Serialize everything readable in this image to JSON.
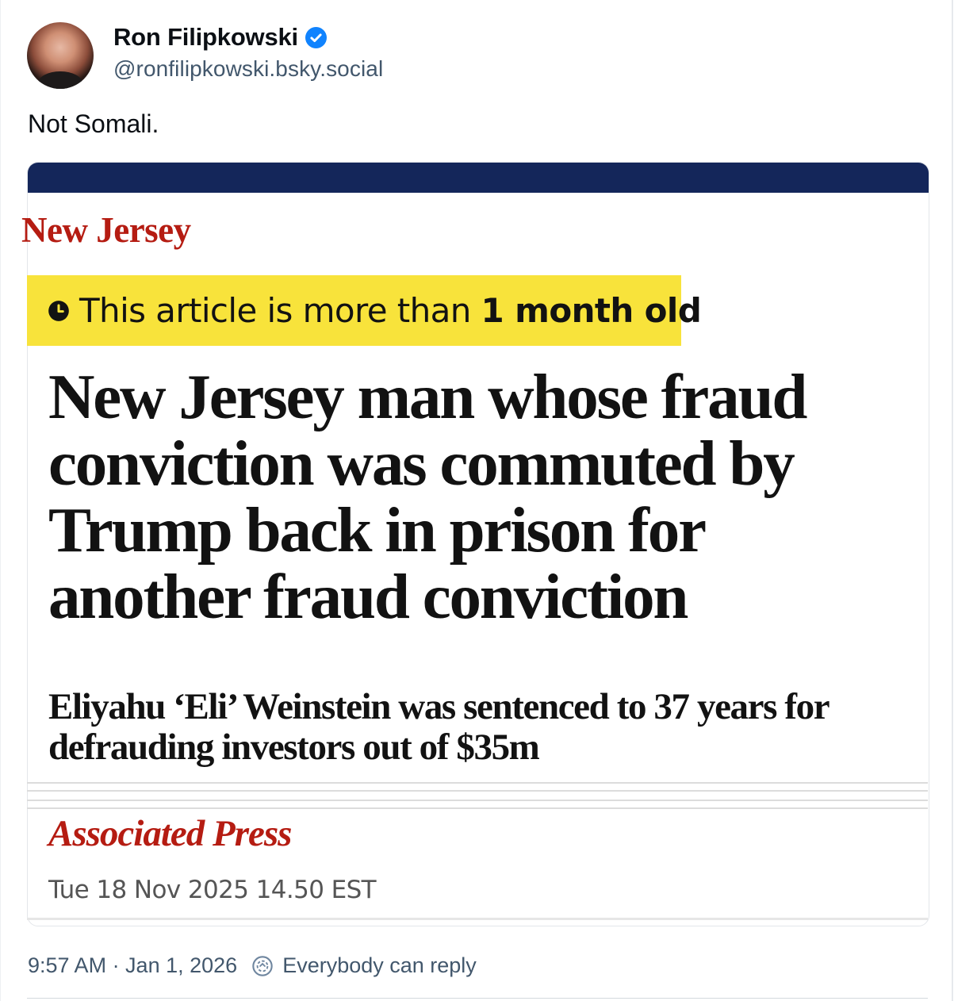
{
  "author": {
    "display_name": "Ron Filipkowski",
    "handle": "@ronfilipkowski.bsky.social",
    "verified": true,
    "avatar_icon": "avatar-photo"
  },
  "post": {
    "text": "Not Somali."
  },
  "embed": {
    "section": "New Jersey",
    "notice_prefix": "This article is more than ",
    "notice_bold": "1 month old",
    "notice_icon": "clock-icon",
    "headline_lines": [
      "New Jersey man whose fraud",
      "conviction was commuted by",
      "Trump back in prison for",
      "another fraud conviction"
    ],
    "standfirst_lines": [
      "Eliyahu ‘Eli’ Weinstein was sentenced to 37 years for",
      "defrauding investors out of $35m"
    ],
    "byline": "Associated Press",
    "dateline": "Tue 18 Nov 2025 14.50 EST",
    "colors": {
      "top_bar": "#14265a",
      "section": "#b51c12",
      "notice_bg": "#f8e33b"
    }
  },
  "meta": {
    "timestamp": "9:57 AM · Jan 1, 2026",
    "reply_setting": "Everybody can reply",
    "reply_icon": "reply-settings-icon"
  }
}
